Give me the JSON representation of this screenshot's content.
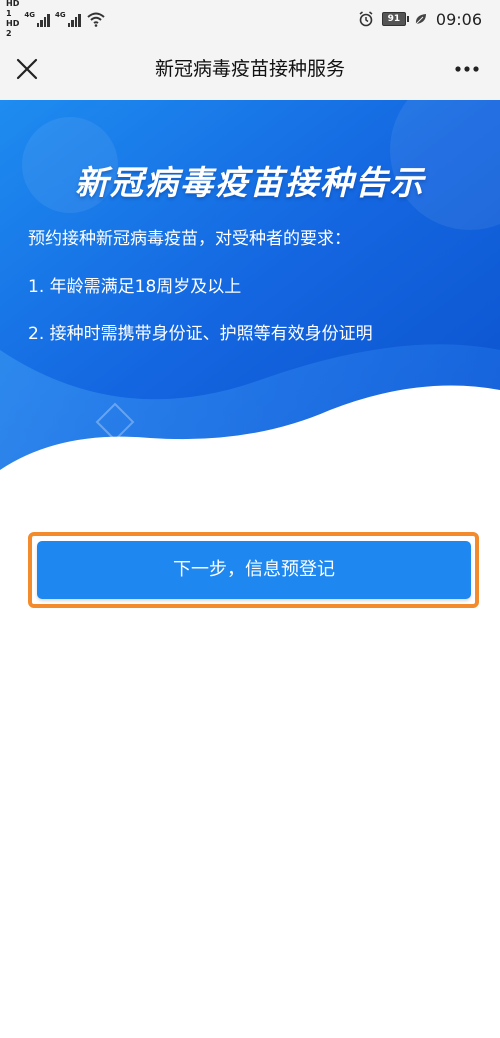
{
  "status_bar": {
    "hd1": "HD",
    "hd1_num": "1",
    "hd2": "HD",
    "hd2_num": "2",
    "net1": "4G",
    "net2": "4G",
    "battery": "91",
    "time": "09:06"
  },
  "nav": {
    "title": "新冠病毒疫苗接种服务",
    "close_icon": "close-icon",
    "more_icon": "more-icon"
  },
  "banner": {
    "title": "新冠病毒疫苗接种告示",
    "intro": "预约接种新冠病毒疫苗，对受种者的要求：",
    "requirements": [
      "1. 年龄需满足18周岁及以上",
      "2. 接种时需携带身份证、护照等有效身份证明"
    ]
  },
  "actions": {
    "next_label": "下一步，信息预登记"
  },
  "colors": {
    "banner_blue": "#1565e0",
    "button_blue": "#1e87f0",
    "highlight_orange": "#f38a2c"
  }
}
